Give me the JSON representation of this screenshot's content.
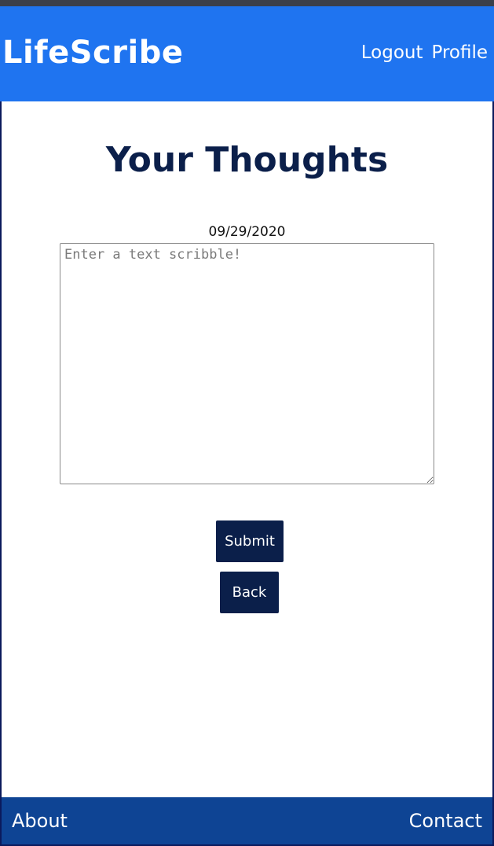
{
  "header": {
    "brand": "LifeScribe",
    "nav": [
      "Logout",
      "Profile"
    ]
  },
  "main": {
    "title": "Your Thoughts",
    "date": "09/29/2020",
    "scribble_placeholder": "Enter a text scribble!",
    "submit_label": "Submit",
    "back_label": "Back"
  },
  "footer": {
    "about_label": "About",
    "contact_label": "Contact"
  },
  "colors": {
    "header_bg": "#1f74f0",
    "footer_bg": "#0e4494",
    "button_bg": "#0b1f4a",
    "title_color": "#0b1f4a"
  }
}
